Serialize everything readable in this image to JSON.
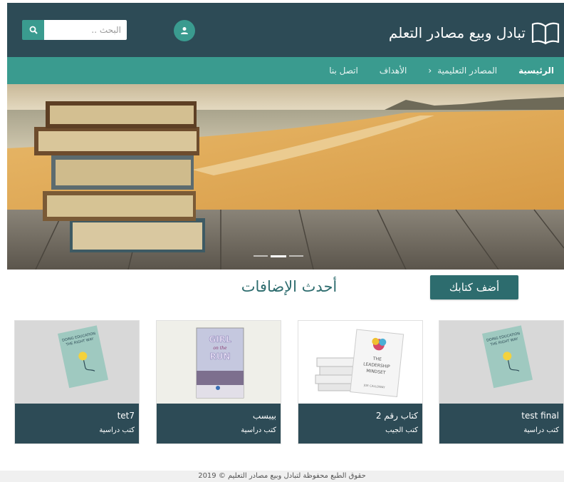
{
  "header": {
    "site_title": "تبادل وبيع مصادر التعلم",
    "search_placeholder": "البحث ..",
    "search_icon": "search-icon",
    "user_icon": "user-icon",
    "logo_icon": "open-book-icon"
  },
  "nav": {
    "items": [
      {
        "label": "الرئيسية",
        "active": true
      },
      {
        "label": "المصادر التعليمية",
        "has_dropdown": true
      },
      {
        "label": "الأهداف"
      },
      {
        "label": "اتصل بنا"
      }
    ]
  },
  "main": {
    "add_button_label": "أضف كتابك",
    "section_title": "أحدث الإضافات",
    "cards": [
      {
        "title": "test final",
        "category": "كتب دراسية",
        "cover": "Doing Education The Right Way"
      },
      {
        "title": "كتاب رقم 2",
        "category": "كتب الجيب",
        "cover": "The Leadership Mindset"
      },
      {
        "title": "بيبسب",
        "category": "كتب دراسية",
        "cover": "Girl on the Run"
      },
      {
        "title": "tet7",
        "category": "كتب دراسية",
        "cover": "Doing Education The Right Way"
      }
    ],
    "cover_texts": {
      "edu_line1": "DOING EDUCATION",
      "edu_line2": "THE RIGHT WAY",
      "lead_line1": "THE",
      "lead_line2": "LEADERSHIP",
      "lead_line3": "MINDSET",
      "lead_author": "JOE CALLOWAY",
      "girl_line1": "GIRL",
      "girl_line2": "on the",
      "girl_line3": "RUN"
    }
  },
  "footer": {
    "text": "حقوق الطبع محفوظة لتبادل وبيع مصادر التعليم © 2019"
  },
  "colors": {
    "header_bg": "#2d4b56",
    "nav_bg": "#3a9b8f",
    "accent": "#2d6c6e",
    "card_footer_bg": "#2d4b56"
  }
}
